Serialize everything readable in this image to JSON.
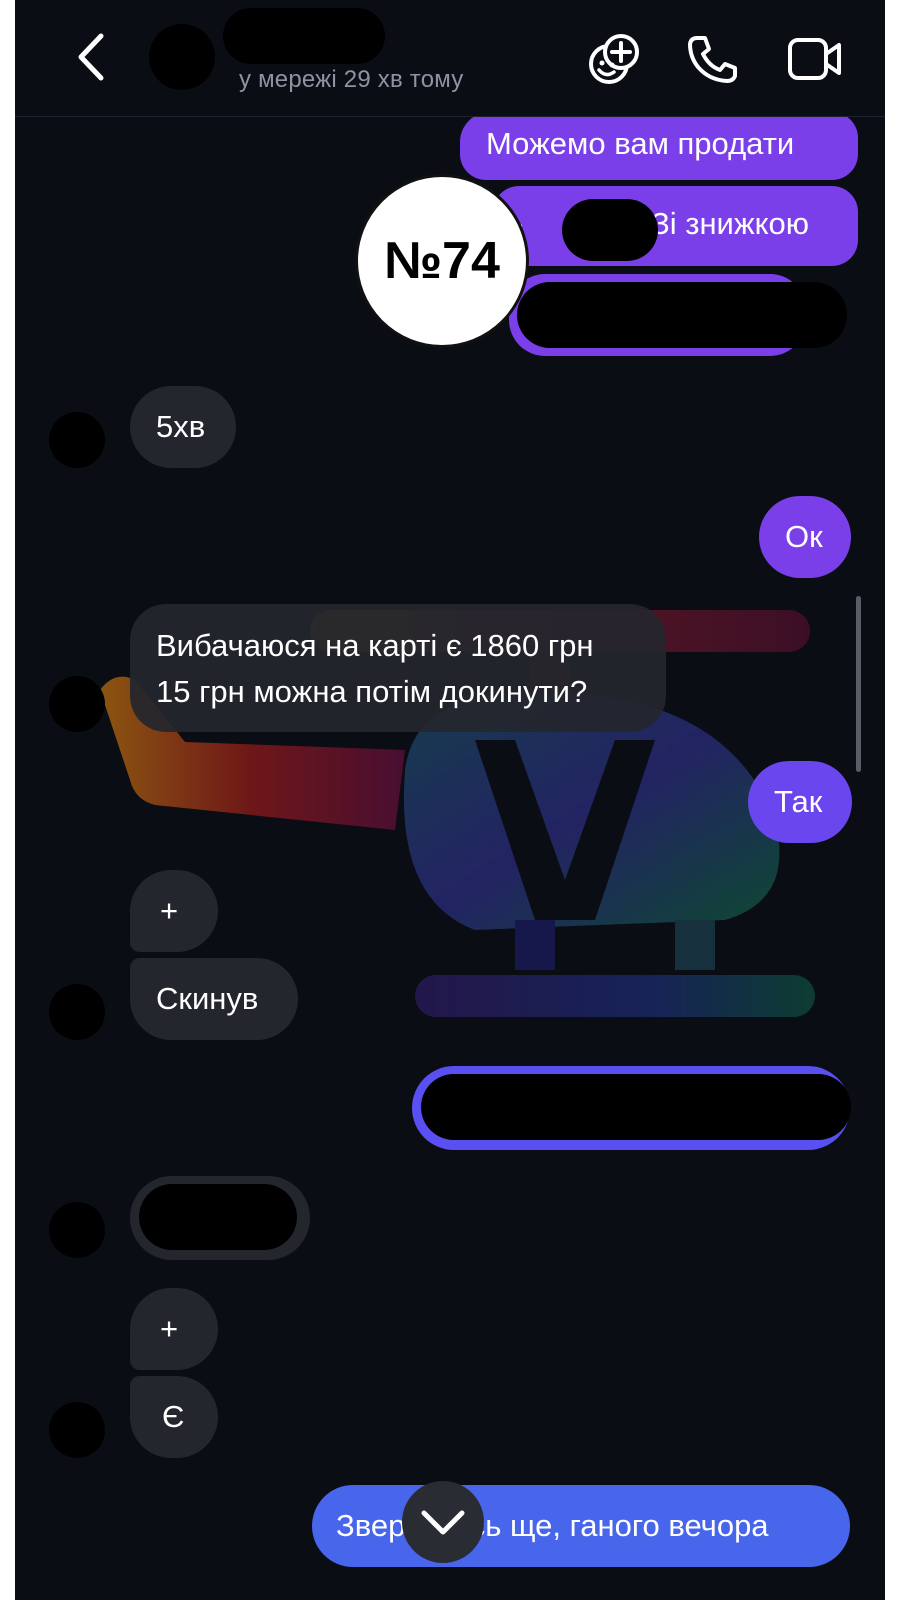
{
  "header": {
    "status": "у мережі 29 хв тому",
    "icons": {
      "back": "chevron-left-icon",
      "sticker": "sticker-add-icon",
      "call": "phone-icon",
      "video": "video-camera-icon"
    }
  },
  "badge": {
    "label": "№74"
  },
  "messages": {
    "m1": "Можемо вам продати",
    "m2_suffix": "Зі знижкою",
    "m2_prefix": "-",
    "m3": "5хв",
    "m4": "Ок",
    "m5_line1": "Вибачаюся на карті є 1860 грн",
    "m5_line2": "15 грн можна потім докинути?",
    "m6": "Так",
    "m7": "+",
    "m8": "Скинув",
    "m9": "+",
    "m10": "Є",
    "m11": "Звернетесь ще, ганого вечора"
  },
  "colors": {
    "background": "#0b0d14",
    "outgoing_bubble": "#7b3fe9",
    "outgoing_bubble_blue": "#5a4ff0",
    "last_bubble": "#4866ec",
    "incoming_bubble": "#24262e"
  }
}
